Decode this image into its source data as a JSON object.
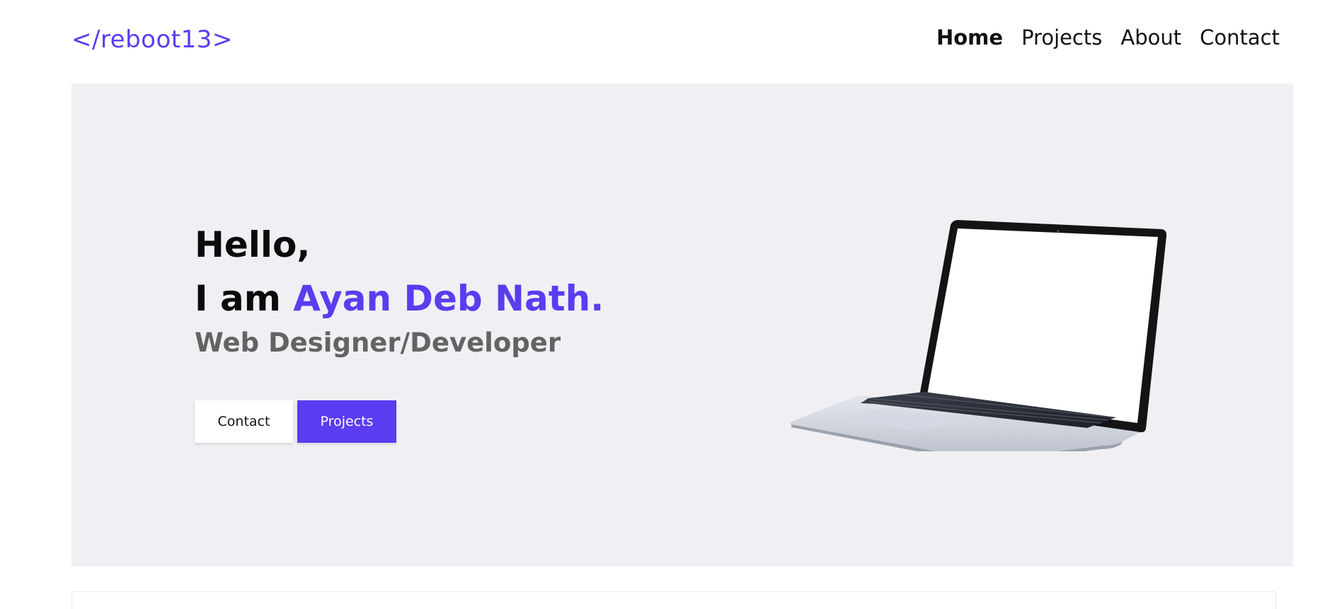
{
  "header": {
    "logo": "</reboot13>",
    "nav": [
      {
        "label": "Home",
        "active": true
      },
      {
        "label": "Projects",
        "active": false
      },
      {
        "label": "About",
        "active": false
      },
      {
        "label": "Contact",
        "active": false
      }
    ]
  },
  "hero": {
    "greeting": "Hello,",
    "intro_prefix": "I am ",
    "name": "Ayan Deb Nath.",
    "role": "Web Designer/Developer",
    "buttons": {
      "contact": "Contact",
      "projects": "Projects"
    },
    "image": "laptop-illustration"
  },
  "colors": {
    "accent": "#5b3cf0",
    "hero_bg": "#f0f0f4",
    "role_text": "#636363"
  }
}
